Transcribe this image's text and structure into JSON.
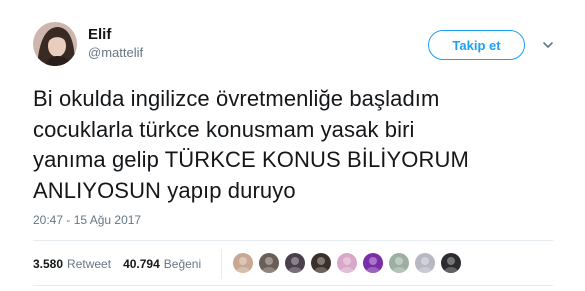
{
  "user": {
    "display_name": "Elif",
    "screen_name": "@mattelif",
    "avatar_icon": "profile-photo"
  },
  "follow_button": {
    "label": "Takip et",
    "color": "#1da1f2"
  },
  "menu_icon": "chevron-down-icon",
  "tweet": {
    "lines": [
      "Bi okulda ingilizce övretmenliğe başladım",
      "cocuklarla türkce konusmam yasak biri",
      "yanıma gelip TÜRKCE KONUS BİLİYORUM",
      "ANLIYOSUN yapıp duruyo"
    ]
  },
  "timestamp": "20:47 - 15 Ağu 2017",
  "stats": {
    "retweet_count": "3.580",
    "retweet_label": "Retweet",
    "like_count": "40.794",
    "like_label": "Beğeni"
  },
  "likers": [
    {
      "icon": "liker-avatar",
      "color": "#c9a892"
    },
    {
      "icon": "liker-avatar",
      "color": "#6b5e57"
    },
    {
      "icon": "liker-avatar",
      "color": "#4a3f4c"
    },
    {
      "icon": "liker-avatar",
      "color": "#3b2f2a"
    },
    {
      "icon": "liker-avatar",
      "color": "#d8a7c9"
    },
    {
      "icon": "liker-avatar",
      "color": "#7a2ea8"
    },
    {
      "icon": "liker-avatar",
      "color": "#9bb0a2"
    },
    {
      "icon": "liker-avatar",
      "color": "#b8b8c4"
    },
    {
      "icon": "liker-avatar",
      "color": "#2c2c30"
    }
  ]
}
